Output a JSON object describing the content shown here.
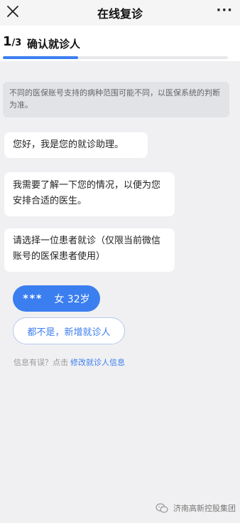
{
  "navbar": {
    "title": "在线复诊",
    "more": "···"
  },
  "step": {
    "current": "1",
    "total": "/3",
    "title": "确认就诊人",
    "progress_fraction": 0.333
  },
  "notice": "不同的医保账号支持的病种范围可能不同，以医保系统的判断为准。",
  "messages": [
    "您好，我是您的就诊助理。",
    "我需要了解一下您的情况，以便为您安排合适的医生。",
    "请选择一位患者就诊（仅限当前微信账号的医保患者使用）"
  ],
  "patient": {
    "name": "***",
    "info": "女 32岁"
  },
  "new_patient_label": "都不是，新增就诊人",
  "info": {
    "prefix": "信息有误？点击",
    "link": "修改就诊人信息"
  },
  "watermark": {
    "text": "济南高新控股集团",
    "icon": "wechat-icon"
  },
  "colors": {
    "accent": "#3b7ef0",
    "background": "#f0f0f2"
  }
}
